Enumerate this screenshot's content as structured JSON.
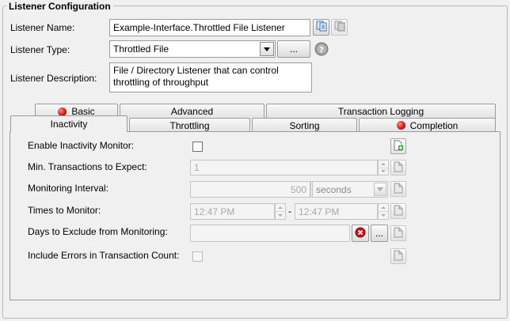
{
  "section": {
    "title": "Listener Configuration"
  },
  "listener": {
    "name_label": "Listener Name:",
    "name_value": "Example-Interface.Throttled File Listener",
    "type_label": "Listener Type:",
    "type_value": "Throttled File",
    "type_more_button": "...",
    "description_label": "Listener Description:",
    "description_value": "File / Directory Listener that can control throttling of throughput"
  },
  "tabs_row1": [
    {
      "label": "Basic",
      "error": true
    },
    {
      "label": "Advanced",
      "error": false
    },
    {
      "label": "Transaction Logging",
      "error": false
    }
  ],
  "tabs_row2": [
    {
      "label": "Inactivity",
      "error": false,
      "active": true
    },
    {
      "label": "Throttling",
      "error": false
    },
    {
      "label": "Sorting",
      "error": false
    },
    {
      "label": "Completion",
      "error": true
    }
  ],
  "inactivity": {
    "enable_label": "Enable Inactivity Monitor:",
    "enable_checked": false,
    "min_tx_label": "Min. Transactions to Expect:",
    "min_tx_value": "1",
    "interval_label": "Monitoring Interval:",
    "interval_value": "500",
    "interval_unit": "seconds",
    "times_label": "Times to Monitor:",
    "time_start": "12:47 PM",
    "time_separator": "-",
    "time_end": "12:47 PM",
    "days_label": "Days to Exclude from Monitoring:",
    "days_value": "",
    "days_more_button": "...",
    "include_errors_label": "Include Errors in Transaction Count:",
    "include_errors_checked": false
  },
  "icons": {
    "copy": "copy-icon",
    "paste": "paste-icon",
    "help": "help-icon",
    "add_doc": "add-document-icon",
    "doc": "document-icon",
    "clear": "clear-icon",
    "error_dot": "error-indicator-icon"
  },
  "colors": {
    "error_red": "#d11010",
    "add_green": "#2aa52a"
  }
}
